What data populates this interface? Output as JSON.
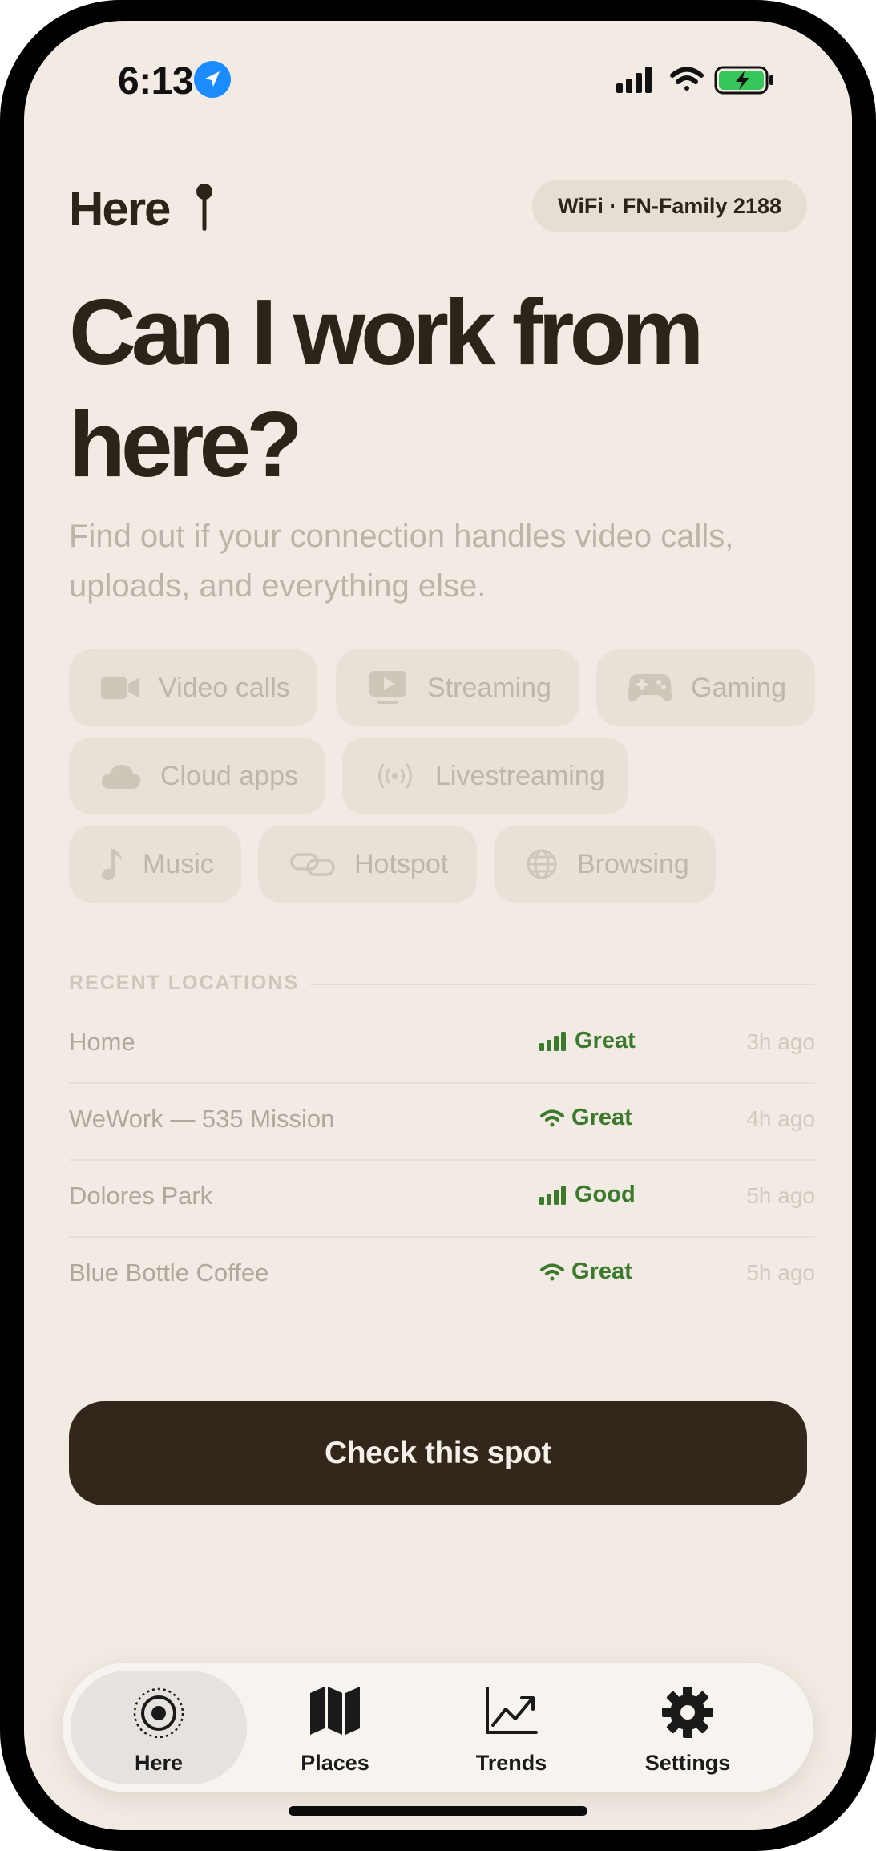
{
  "status_bar": {
    "time": "6:13"
  },
  "header": {
    "brand": "Here",
    "network_chip": "WiFi · FN-Family 2188"
  },
  "hero": {
    "headline_line1": "Can I work from",
    "headline_line2": "here?",
    "subtitle": "Find out if your connection handles video calls, uploads, and everything else."
  },
  "activities": [
    {
      "label": "Video calls",
      "icon": "video-camera-icon"
    },
    {
      "label": "Streaming",
      "icon": "play-screen-icon"
    },
    {
      "label": "Gaming",
      "icon": "gamepad-icon"
    },
    {
      "label": "Cloud apps",
      "icon": "cloud-icon"
    },
    {
      "label": "Livestreaming",
      "icon": "broadcast-icon"
    },
    {
      "label": "Music",
      "icon": "music-note-icon"
    },
    {
      "label": "Hotspot",
      "icon": "link-icon"
    },
    {
      "label": "Browsing",
      "icon": "globe-icon"
    }
  ],
  "recent": {
    "section_label": "RECENT LOCATIONS",
    "items": [
      {
        "name": "Home",
        "signal_type": "cellular",
        "status": "Great",
        "time": "3h ago"
      },
      {
        "name": "WeWork — 535 Mission",
        "signal_type": "wifi",
        "status": "Great",
        "time": "4h ago"
      },
      {
        "name": "Dolores Park",
        "signal_type": "cellular",
        "status": "Good",
        "time": "5h ago"
      },
      {
        "name": "Blue Bottle Coffee",
        "signal_type": "wifi",
        "status": "Great",
        "time": "5h ago"
      }
    ]
  },
  "cta": {
    "label": "Check this spot"
  },
  "tabs": [
    {
      "label": "Here",
      "icon": "target-icon",
      "active": true
    },
    {
      "label": "Places",
      "icon": "map-icon",
      "active": false
    },
    {
      "label": "Trends",
      "icon": "chart-icon",
      "active": false
    },
    {
      "label": "Settings",
      "icon": "gear-icon",
      "active": false
    }
  ],
  "colors": {
    "background": "#f1ebe3",
    "ink": "#2c2419",
    "status_green": "#3b7a2c",
    "cta": "#33271b"
  }
}
